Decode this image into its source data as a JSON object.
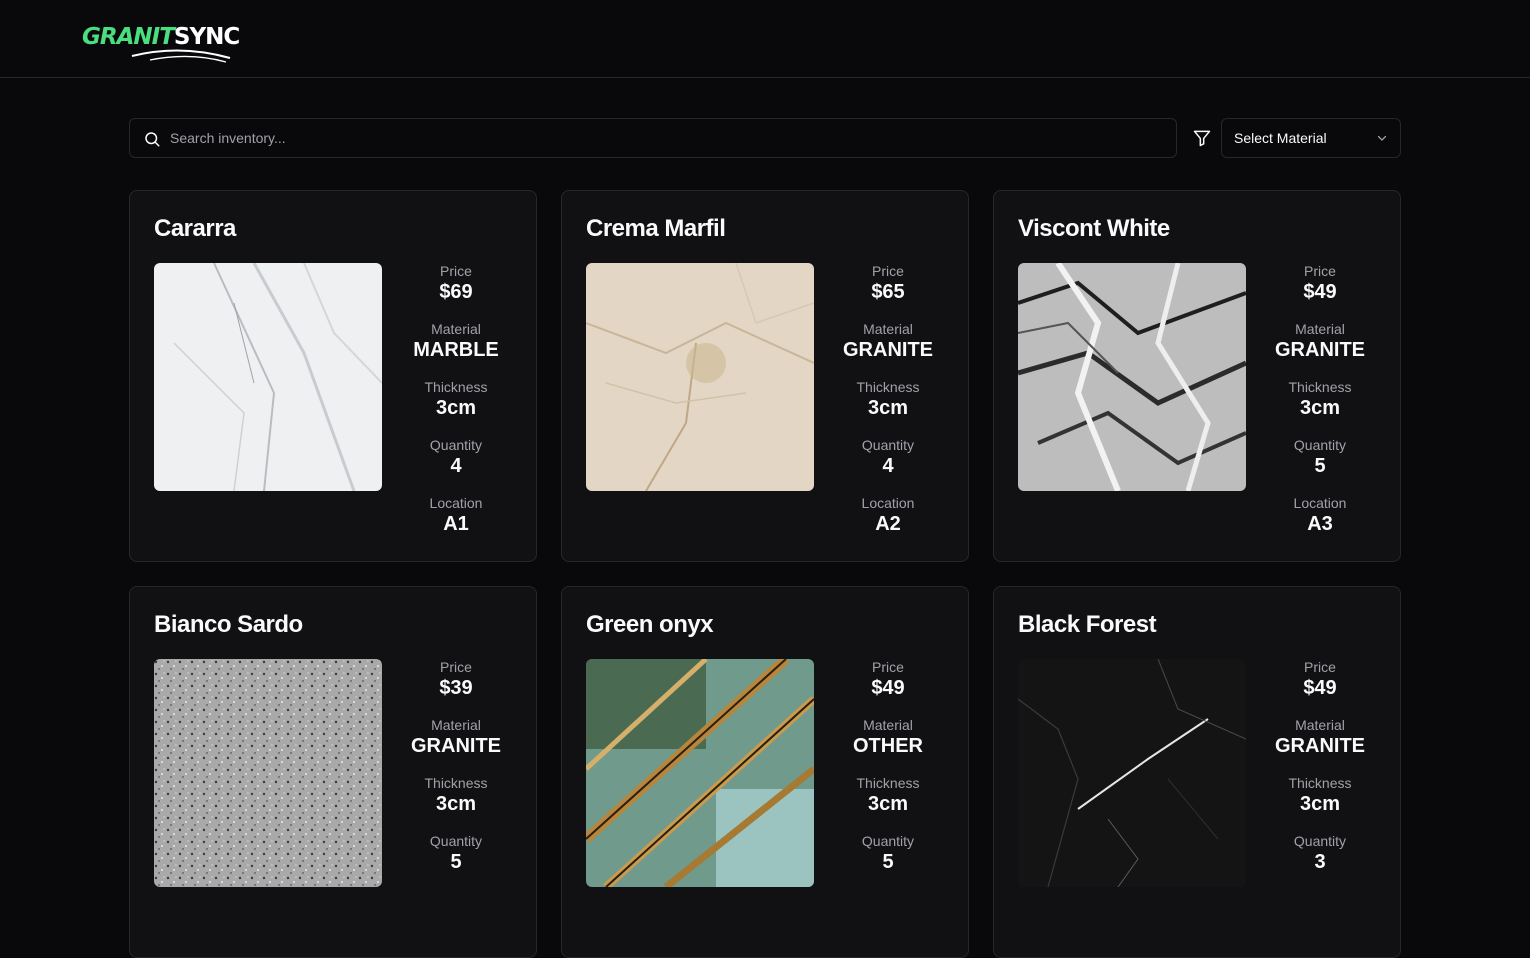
{
  "brand": {
    "part1": "GRANIT",
    "part2": "SYNC"
  },
  "search": {
    "placeholder": "Search inventory..."
  },
  "filter": {
    "selected": "Select Material"
  },
  "labels": {
    "price": "Price",
    "material": "Material",
    "thickness": "Thickness",
    "quantity": "Quantity",
    "location": "Location"
  },
  "inventory": [
    {
      "name": "Cararra",
      "price": "$69",
      "material": "MARBLE",
      "thickness": "3cm",
      "quantity": "4",
      "location": "A1"
    },
    {
      "name": "Crema Marfil",
      "price": "$65",
      "material": "GRANITE",
      "thickness": "3cm",
      "quantity": "4",
      "location": "A2"
    },
    {
      "name": "Viscont White",
      "price": "$49",
      "material": "GRANITE",
      "thickness": "3cm",
      "quantity": "5",
      "location": "A3"
    },
    {
      "name": "Bianco Sardo",
      "price": "$39",
      "material": "GRANITE",
      "thickness": "3cm",
      "quantity": "5"
    },
    {
      "name": "Green onyx",
      "price": "$49",
      "material": "OTHER",
      "thickness": "3cm",
      "quantity": "5"
    },
    {
      "name": "Black Forest",
      "price": "$49",
      "material": "GRANITE",
      "thickness": "3cm",
      "quantity": "3"
    }
  ],
  "colors": {
    "accent": "#4ade80",
    "background": "#09090b",
    "card": "#111113",
    "border": "#27272a",
    "muted": "#a1a1aa"
  }
}
